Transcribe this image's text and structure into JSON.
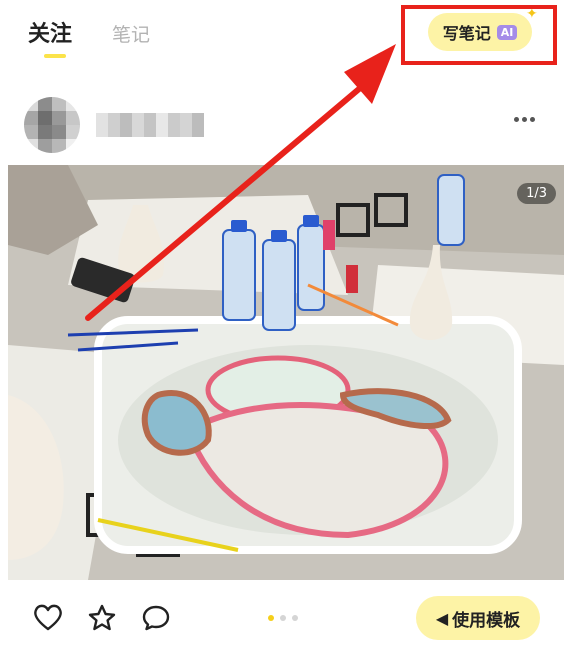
{
  "header": {
    "tabs": [
      {
        "label": "关注",
        "active": true
      },
      {
        "label": "笔记",
        "active": false
      }
    ],
    "write_button": {
      "label": "写笔记",
      "badge": "AI"
    },
    "colors": {
      "accent_yellow": "#fbe34a",
      "button_bg": "#fdf3a6",
      "ai_badge": "#a58ce8",
      "sparkle": "#f5c518",
      "highlight_border": "#e8221b",
      "arrow": "#e8221b"
    }
  },
  "post": {
    "author_avatar_icon": "blurred-avatar",
    "author_name_icon": "blurred-username",
    "more_icon": "more-horizontal-icon",
    "image_counter": "1/3"
  },
  "bottom_bar": {
    "icons": [
      "heart-icon",
      "star-icon",
      "comment-icon"
    ],
    "page_dots": {
      "count": 3,
      "active_index": 0
    },
    "template_button": {
      "label": "使用模板",
      "icon": "template-icon"
    },
    "colors": {
      "template_bg": "#fdf3a6",
      "dot_active": "#f5cf1a",
      "dot_inactive": "#d5d5d5"
    }
  }
}
